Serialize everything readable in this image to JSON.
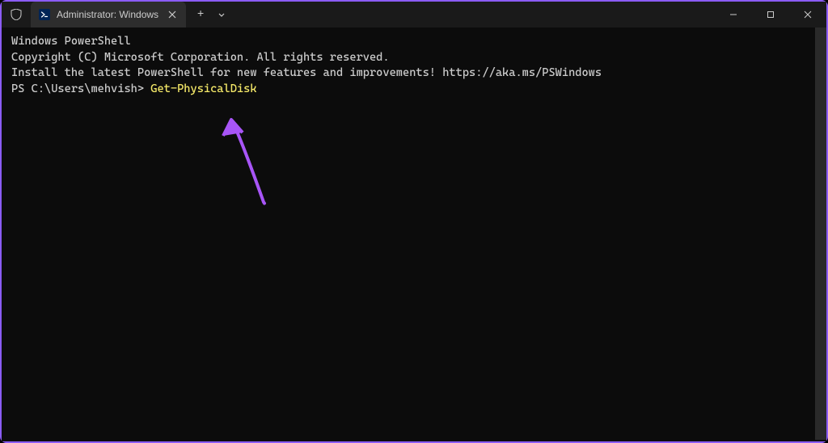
{
  "window": {
    "tab_title": "Administrator: Windows",
    "new_tab_symbol": "+",
    "dropdown_symbol": "⌄"
  },
  "terminal": {
    "line1": "Windows PowerShell",
    "line2": "Copyright (C) Microsoft Corporation. All rights reserved.",
    "line3": "",
    "line4": "Install the latest PowerShell for new features and improvements! https://aka.ms/PSWindows",
    "line5": "",
    "prompt": "PS C:\\Users\\mehvish> ",
    "command": "Get-PhysicalDisk"
  },
  "annotation": {
    "arrow_color": "#a855f7"
  }
}
